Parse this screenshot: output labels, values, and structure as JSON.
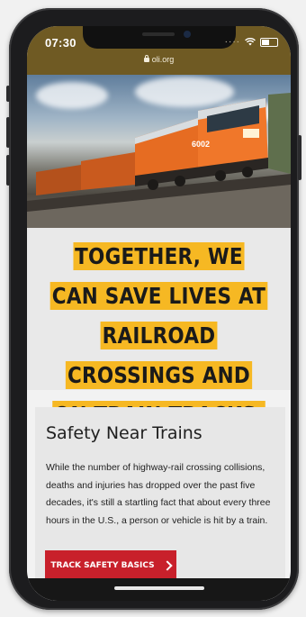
{
  "status_bar": {
    "time": "07:30",
    "signal_icon": "dots-icon",
    "wifi_icon": "wifi-icon",
    "battery_icon": "battery-icon"
  },
  "browser": {
    "url": "oli.org",
    "lock_icon": "lock-icon"
  },
  "hero": {
    "image_subject": "orange freight locomotive",
    "locomotive_number": "6002"
  },
  "headline": "TOGETHER, WE CAN SAVE LIVES AT RAILROAD CROSSINGS AND ON TRAIN TRACKS.",
  "section": {
    "title": "Safety Near Trains",
    "body": "While the number of highway-rail crossing collisions, deaths and injuries has dropped over the past five decades, it's still a startling fact that about every three hours in the U.S., a person or vehicle is hit by a train.",
    "cta_label": "TRACK SAFETY BASICS"
  },
  "colors": {
    "accent": "#f6b823",
    "cta": "#c8202b",
    "status_bar": "#6f5a23"
  }
}
